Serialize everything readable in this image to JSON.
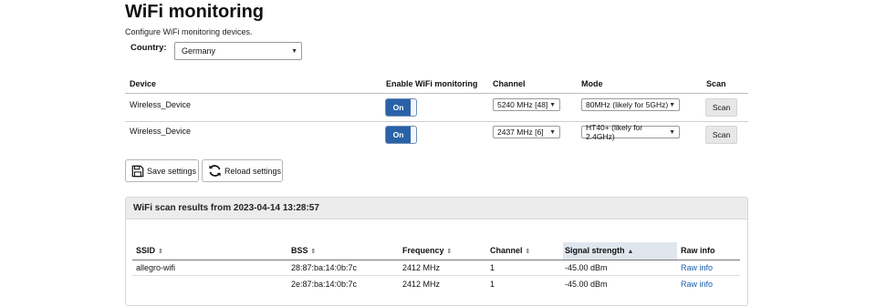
{
  "page": {
    "title": "WiFi monitoring",
    "subtitle": "Configure WiFi monitoring devices."
  },
  "country": {
    "label": "Country:",
    "value": "Germany"
  },
  "devices_table": {
    "headers": {
      "device": "Device",
      "enable": "Enable WiFi monitoring",
      "channel": "Channel",
      "mode": "Mode",
      "scan": "Scan"
    },
    "rows": [
      {
        "device": "Wireless_Device",
        "toggle": "On",
        "channel": "5240 MHz [48]",
        "mode": "80MHz (likely for 5GHz)",
        "scan": "Scan"
      },
      {
        "device": "Wireless_Device",
        "toggle": "On",
        "channel": "2437 MHz [6]",
        "mode": "HT40+ (likely for 2.4GHz)",
        "scan": "Scan"
      }
    ]
  },
  "actions": {
    "save": "Save settings",
    "reload": "Reload settings"
  },
  "scan_results": {
    "heading": "WiFi scan results from 2023-04-14 13:28:57",
    "headers": {
      "ssid": "SSID",
      "bss": "BSS",
      "frequency": "Frequency",
      "channel": "Channel",
      "signal": "Signal strength",
      "raw": "Raw info"
    },
    "sorted_column": "Signal strength",
    "rows": [
      {
        "ssid": "allegro-wifi",
        "bss": "28:87:ba:14:0b:7c",
        "frequency": "2412 MHz",
        "channel": "1",
        "signal": "-45.00 dBm",
        "raw": "Raw info"
      },
      {
        "ssid": "",
        "bss": "2e:87:ba:14:0b:7c",
        "frequency": "2412 MHz",
        "channel": "1",
        "signal": "-45.00 dBm",
        "raw": "Raw info"
      }
    ]
  },
  "colors": {
    "toggle_on": "#2a62a8",
    "link": "#1a5ea8",
    "sorted_header": "#dfe6ee"
  },
  "icons": {
    "sortable": "sort-both-icon",
    "sorted_asc": "sort-up-icon",
    "save": "floppy-disk-icon",
    "reload": "refresh-icon"
  }
}
